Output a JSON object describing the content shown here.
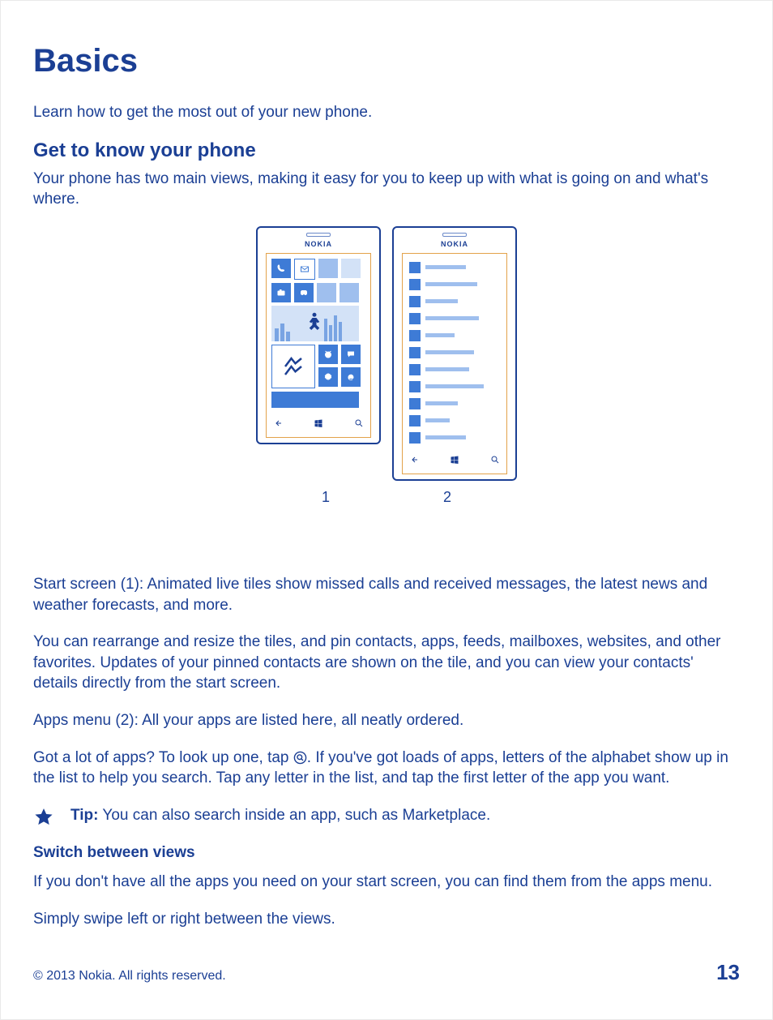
{
  "title": "Basics",
  "intro": "Learn how to get the most out of your new phone.",
  "section1": {
    "heading": "Get to know your phone",
    "lead": "Your phone has two main views, making it easy for you to keep up with what is going on and what's where."
  },
  "phone_label": "NOKIA",
  "figure_captions": [
    "1",
    "2"
  ],
  "para_start_screen": "Start screen (1): Animated live tiles show missed calls and received messages, the latest news and weather forecasts, and more.",
  "para_rearrange": "You can rearrange and resize the tiles, and pin contacts, apps, feeds, mailboxes, websites, and other favorites. Updates of your pinned contacts are shown on the tile, and you can view your contacts' details directly from the start screen.",
  "para_apps_menu": "Apps menu (2): All your apps are listed here, all neatly ordered.",
  "para_lookup_before": "Got a lot of apps? To look up one, tap ",
  "para_lookup_after": ". If you've got loads of apps, letters of the alphabet show up in the list to help you search. Tap any letter in the list, and tap the first letter of the app you want.",
  "tip_label": "Tip:",
  "tip_text": " You can also search inside an app, such as Marketplace.",
  "sub_heading": "Switch between views",
  "para_switch1": "If you don't have all the apps you need on your start screen, you can find them from the apps menu.",
  "para_switch2": "Simply swipe left or right between the views.",
  "copyright": "© 2013 Nokia. All rights reserved.",
  "page_number": "13",
  "app_line_widths": [
    50,
    64,
    40,
    66,
    36,
    60,
    54,
    72,
    40,
    30,
    50
  ]
}
